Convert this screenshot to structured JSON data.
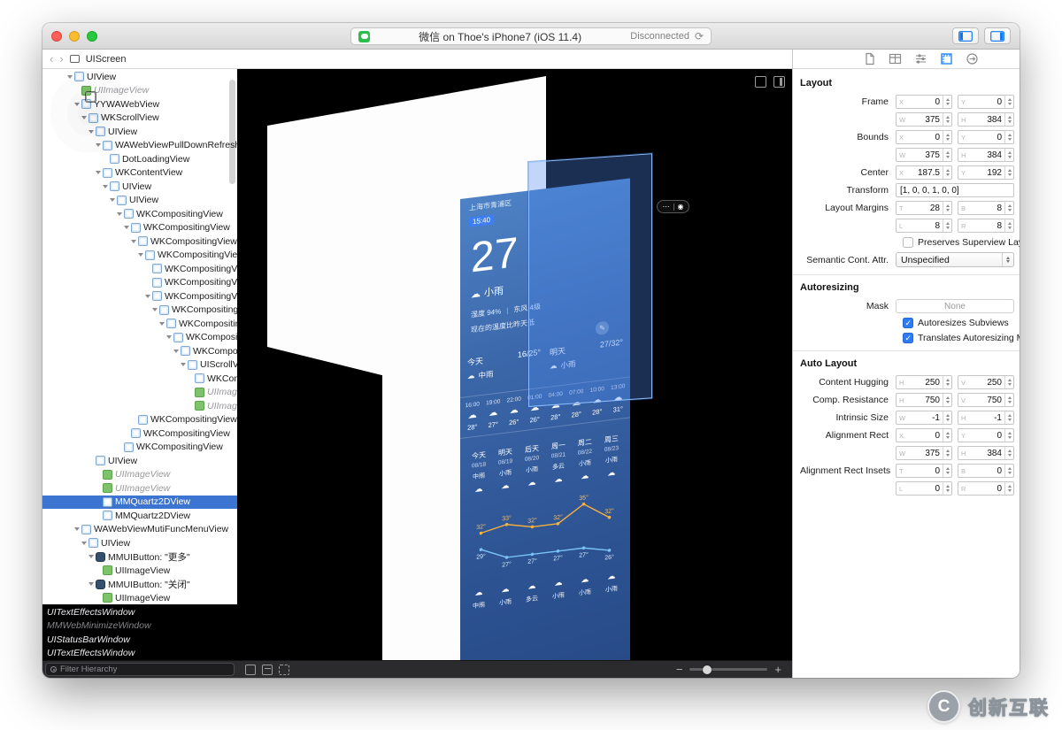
{
  "window": {
    "title": "微信 on Thoe's iPhone7 (iOS 11.4)",
    "status": "Disconnected",
    "refresh_glyph": "⟳",
    "back_glyph": "‹",
    "forward_glyph": "›",
    "jump_bar": "UIScreen",
    "filter_placeholder": "Filter Hierarchy",
    "zoom_out_glyph": "−",
    "zoom_in_glyph": "+"
  },
  "sidebar": {
    "tree": [
      {
        "label": "UIView",
        "lvl": 3,
        "icon": "view",
        "tri": true
      },
      {
        "label": "UIImageView",
        "lvl": 4,
        "icon": "image",
        "italic": true
      },
      {
        "label": "YYWAWebView",
        "lvl": 4,
        "icon": "web",
        "tri": true
      },
      {
        "label": "WKScrollView",
        "lvl": 5,
        "icon": "scroll",
        "tri": true
      },
      {
        "label": "UIView",
        "lvl": 6,
        "icon": "view",
        "tri": true
      },
      {
        "label": "WAWebViewPullDownRefreshView",
        "lvl": 7,
        "icon": "view",
        "tri": true
      },
      {
        "label": "DotLoadingView",
        "lvl": 8,
        "icon": "view"
      },
      {
        "label": "WKContentView",
        "lvl": 7,
        "icon": "view",
        "tri": true
      },
      {
        "label": "UIView",
        "lvl": 8,
        "ic": "",
        "icon": "view",
        "tri": true
      },
      {
        "label": "UIView",
        "lvl": 9,
        "icon": "view",
        "tri": true
      },
      {
        "label": "WKCompositingView",
        "lvl": 10,
        "icon": "view",
        "tri": true
      },
      {
        "label": "WKCompositingView",
        "lvl": 11,
        "icon": "view",
        "tri": true
      },
      {
        "label": "WKCompositingView",
        "lvl": 12,
        "icon": "view",
        "tri": true
      },
      {
        "label": "WKCompositingView",
        "lvl": 13,
        "icon": "view",
        "tri": true
      },
      {
        "label": "WKCompositingView",
        "lvl": 14,
        "icon": "view"
      },
      {
        "label": "WKCompositingView",
        "lvl": 14,
        "icon": "view"
      },
      {
        "label": "WKCompositingView",
        "lvl": 14,
        "icon": "view",
        "tri": true
      },
      {
        "label": "WKCompositingView",
        "lvl": 15,
        "icon": "view",
        "tri": true
      },
      {
        "label": "WKCompositingView",
        "lvl": 16,
        "icon": "view",
        "tri": true
      },
      {
        "label": "WKCompositingView",
        "lvl": 17,
        "icon": "view",
        "tri": true
      },
      {
        "label": "WKCompositingView",
        "lvl": 18,
        "icon": "view",
        "tri": true
      },
      {
        "label": "UIScrollView",
        "lvl": 19,
        "icon": "scroll",
        "tri": true
      },
      {
        "label": "WKCompositingView",
        "lvl": 20,
        "icon": "view"
      },
      {
        "label": "UIImageView",
        "lvl": 20,
        "icon": "image",
        "italic": true
      },
      {
        "label": "UIImageView",
        "lvl": 20,
        "icon": "image",
        "italic": true
      },
      {
        "label": "WKCompositingView",
        "lvl": 12,
        "icon": "view"
      },
      {
        "label": "WKCompositingView",
        "lvl": 11,
        "icon": "view"
      },
      {
        "label": "WKCompositingView",
        "lvl": 10,
        "icon": "view"
      },
      {
        "label": "UIView",
        "lvl": 6,
        "icon": "view"
      },
      {
        "label": "UIImageView",
        "lvl": 7,
        "icon": "image",
        "italic": true
      },
      {
        "label": "UIImageView",
        "lvl": 7,
        "icon": "image",
        "italic": true
      },
      {
        "label": "MMQuartz2DView",
        "lvl": 7,
        "icon": "view",
        "sel": true
      },
      {
        "label": "MMQuartz2DView",
        "lvl": 7,
        "icon": "view"
      },
      {
        "label": "WAWebViewMutiFuncMenuView",
        "lvl": 4,
        "icon": "view",
        "tri": true
      },
      {
        "label": "UIView",
        "lvl": 5,
        "icon": "view",
        "tri": true
      },
      {
        "label": "MMUIButton: \"更多\"",
        "lvl": 6,
        "icon": "button",
        "tri": true
      },
      {
        "label": "UIImageView",
        "lvl": 7,
        "icon": "image"
      },
      {
        "label": "MMUIButton: \"关闭\"",
        "lvl": 6,
        "icon": "button",
        "tri": true
      },
      {
        "label": "UIImageView",
        "lvl": 7,
        "icon": "image"
      }
    ],
    "windows": [
      {
        "label": "UITextEffectsWindow",
        "dim": false
      },
      {
        "label": "MMWebMinimizeWindow",
        "dim": true
      },
      {
        "label": "UIStatusBarWindow",
        "dim": false
      },
      {
        "label": "UITextEffectsWindow",
        "dim": false
      }
    ]
  },
  "canvas": {
    "capsule": {
      "more": "⋯",
      "record": "◉"
    },
    "weather": {
      "location": "上海市青浦区",
      "time_badge": "15:40",
      "temp": "27",
      "condition": "小雨",
      "humidity": "湿度 94%",
      "wind": "东风 4级",
      "note": "现在的温度比昨天低",
      "days": [
        {
          "day": "今天",
          "range": "16/25°",
          "desc": "中雨"
        },
        {
          "day": "明天",
          "range": "27/32°",
          "desc": "小雨"
        }
      ],
      "hourly": {
        "times": [
          "16:00",
          "19:00",
          "22:00",
          "01:00",
          "04:00",
          "07:00",
          "10:00",
          "13:00"
        ],
        "temps": [
          "28°",
          "27°",
          "26°",
          "26°",
          "28°",
          "28°",
          "28°",
          "31°"
        ]
      },
      "weekly": {
        "days": [
          "今天",
          "明天",
          "后天",
          "周一",
          "周二",
          "周三"
        ],
        "dates": [
          "08/18",
          "08/19",
          "08/20",
          "08/21",
          "08/22",
          "08/23"
        ],
        "descs": [
          "中雨",
          "小雨",
          "小雨",
          "多云",
          "小雨",
          "小雨"
        ],
        "highs": [
          32,
          33,
          32,
          32,
          35,
          32
        ],
        "lows": [
          29,
          27,
          27,
          27,
          27,
          26
        ],
        "descs2": [
          "中雨",
          "小雨",
          "多云",
          "小雨",
          "小雨",
          "小雨"
        ]
      }
    }
  },
  "inspector": {
    "tabs": [
      "file-inspector",
      "quick-help",
      "attributes-inspector",
      "size-inspector",
      "connections-inspector"
    ],
    "active_tab": 3,
    "sections": [
      {
        "title": "Layout",
        "rows": [
          {
            "label": "Frame",
            "fields": [
              [
                "X",
                "0"
              ],
              [
                "Y",
                "0"
              ],
              [
                "W",
                "375"
              ],
              [
                "H",
                "384"
              ]
            ]
          },
          {
            "label": "Bounds",
            "fields": [
              [
                "X",
                "0"
              ],
              [
                "Y",
                "0"
              ],
              [
                "W",
                "375"
              ],
              [
                "H",
                "384"
              ]
            ]
          },
          {
            "label": "Center",
            "fields": [
              [
                "X",
                "187.5"
              ],
              [
                "Y",
                "192"
              ]
            ]
          },
          {
            "label": "Transform",
            "wide": "[1, 0, 0, 1, 0, 0]"
          },
          {
            "label": "Layout Margins",
            "fields": [
              [
                "T",
                "28"
              ],
              [
                "B",
                "8"
              ],
              [
                "L",
                "8"
              ],
              [
                "R",
                "8"
              ]
            ]
          },
          {
            "check": "Preserves Superview Layou...",
            "checked": false
          },
          {
            "label": "Semantic Cont. Attr.",
            "popup": "Unspecified"
          }
        ]
      },
      {
        "title": "Autoresizing",
        "rows": [
          {
            "label": "Mask",
            "mask": "None"
          },
          {
            "check": "Autoresizes Subviews",
            "checked": true
          },
          {
            "check": "Translates Autoresizing Ma...",
            "checked": true
          }
        ]
      },
      {
        "title": "Auto Layout",
        "rows": [
          {
            "label": "Content Hugging",
            "fields": [
              [
                "H",
                "250"
              ],
              [
                "V",
                "250"
              ]
            ]
          },
          {
            "label": "Comp. Resistance",
            "fields": [
              [
                "H",
                "750"
              ],
              [
                "V",
                "750"
              ]
            ]
          },
          {
            "label": "Intrinsic Size",
            "fields": [
              [
                "W",
                "-1"
              ],
              [
                "H",
                "-1"
              ]
            ]
          },
          {
            "label": "Alignment Rect",
            "fields": [
              [
                "X",
                "0"
              ],
              [
                "Y",
                "0"
              ],
              [
                "W",
                "375"
              ],
              [
                "H",
                "384"
              ]
            ]
          },
          {
            "label": "Alignment Rect Insets",
            "fields": [
              [
                "T",
                "0"
              ],
              [
                "B",
                "0"
              ],
              [
                "L",
                "0"
              ],
              [
                "R",
                "0"
              ]
            ]
          }
        ]
      }
    ]
  },
  "watermark": {
    "brand": "创新互联",
    "logo_letter": "C"
  }
}
